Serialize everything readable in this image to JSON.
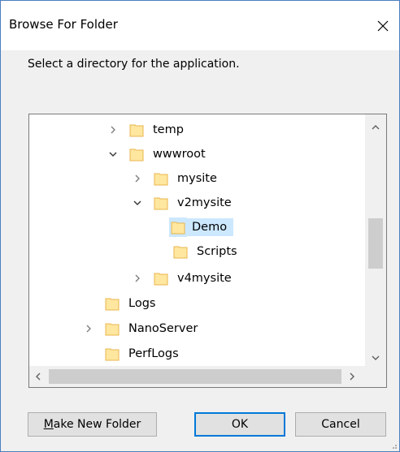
{
  "window": {
    "title": "Browse For Folder"
  },
  "prompt": "Select a directory for the application.",
  "tree": {
    "items": [
      {
        "label": "temp",
        "expander": "collapsed",
        "selected": false
      },
      {
        "label": "wwwroot",
        "expander": "expanded",
        "selected": false
      },
      {
        "label": "mysite",
        "expander": "collapsed",
        "selected": false
      },
      {
        "label": "v2mysite",
        "expander": "expanded",
        "selected": false
      },
      {
        "label": "Demo",
        "expander": "none",
        "selected": true
      },
      {
        "label": "Scripts",
        "expander": "none",
        "selected": false
      },
      {
        "label": "v4mysite",
        "expander": "collapsed",
        "selected": false
      },
      {
        "label": "Logs",
        "expander": "none",
        "selected": false
      },
      {
        "label": "NanoServer",
        "expander": "collapsed",
        "selected": false
      },
      {
        "label": "PerfLogs",
        "expander": "none",
        "selected": false
      }
    ]
  },
  "buttons": {
    "new_folder": "Make New Folder",
    "new_folder_mnemonic": "M",
    "new_folder_rest": "ake New Folder",
    "ok": "OK",
    "cancel": "Cancel"
  },
  "colors": {
    "selection": "#cce8ff",
    "folder": "#ffe7a0",
    "folder_edge": "#e8b64c",
    "default_button_border": "#0078d7"
  },
  "icons": {
    "close": "close-icon",
    "folder": "folder-icon",
    "expand": "chevron-right-icon",
    "collapse": "chevron-down-icon",
    "scroll_up": "scroll-up-icon",
    "scroll_down": "scroll-down-icon",
    "scroll_left": "scroll-left-icon",
    "scroll_right": "scroll-right-icon"
  }
}
